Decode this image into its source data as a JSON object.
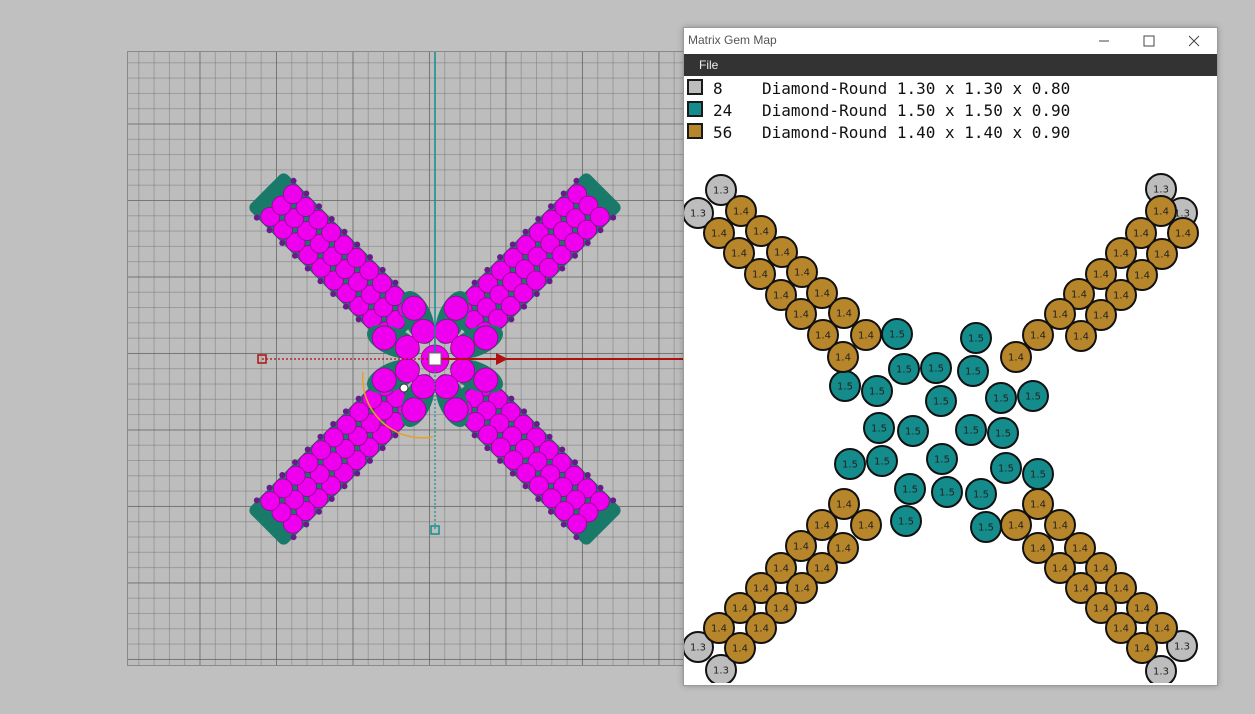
{
  "window": {
    "title": "Matrix Gem Map",
    "menu_file": "File"
  },
  "legend": [
    {
      "count": "8",
      "desc": "Diamond-Round 1.30 x 1.30 x 0.80",
      "color": "#bdbdbd"
    },
    {
      "count": "24",
      "desc": "Diamond-Round 1.50 x 1.50 x 0.90",
      "color": "#148c8c"
    },
    {
      "count": "56",
      "desc": "Diamond-Round 1.40 x 1.40 x 0.90",
      "color": "#b8862a"
    }
  ],
  "gem_types": {
    "s13": {
      "label": "1.3",
      "color": "#bdbdbd"
    },
    "s15": {
      "label": "1.5",
      "color": "#148c8c"
    },
    "s14": {
      "label": "1.4",
      "color": "#b8862a"
    }
  },
  "viewport": {
    "gem_color": "#ee00ee",
    "prong_color": "#6a1a8a",
    "setting_color": "#1a7a6a",
    "axis_x_color": "#b01010",
    "axis_y_color": "#109090"
  }
}
